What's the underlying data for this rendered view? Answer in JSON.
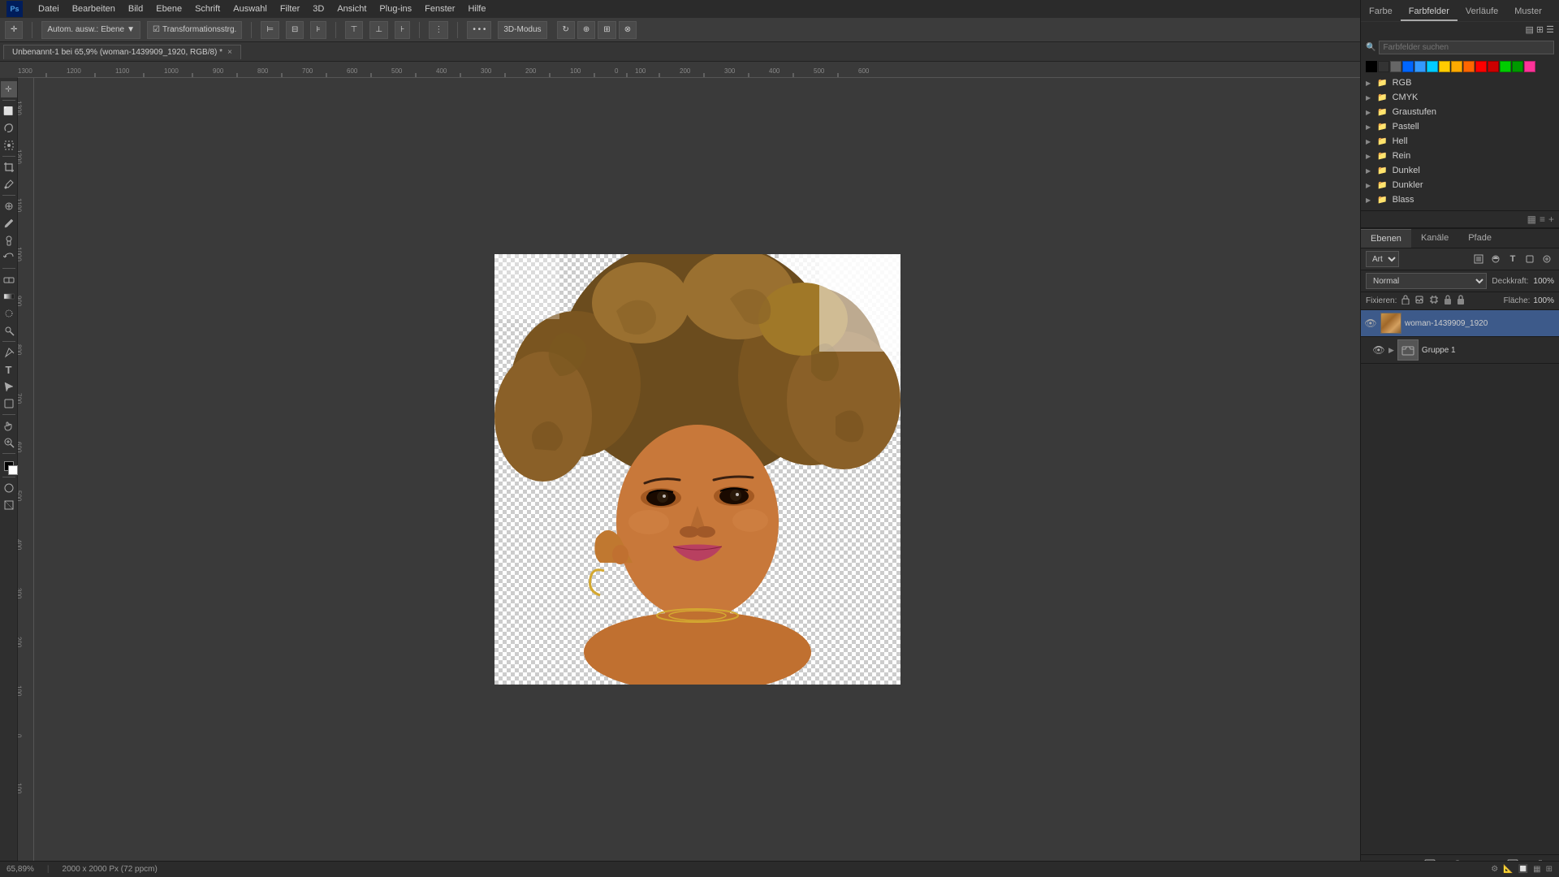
{
  "app": {
    "title": "Adobe Photoshop",
    "ps_label": "Ps"
  },
  "titlebar": {
    "menu_items": [
      "Datei",
      "Bearbeiten",
      "Bild",
      "Ebene",
      "Schrift",
      "Auswahl",
      "Filter",
      "3D",
      "Ansicht",
      "Plug-ins",
      "Fenster",
      "Hilfe"
    ],
    "window_title": "Unbenannt-1 bei 65,9% (woman-1439909_1920, RGB/8) *",
    "close_tab": "×"
  },
  "optionsbar": {
    "auto_label": "Autom. ausw.:",
    "ebene_label": "Ebene",
    "transformation_label": "Transformationsstrg.",
    "mode_3d_label": "3D-Modus"
  },
  "swatches": {
    "colors": [
      "#000000",
      "#333333",
      "#666666",
      "#0066ff",
      "#3399ff",
      "#ffcc00",
      "#ffaa00",
      "#ff6600",
      "#ff0000",
      "#cc0000",
      "#00cc00",
      "#009900",
      "#ff3399",
      "#cc0066"
    ]
  },
  "color_panel": {
    "tabs": [
      "Farbe",
      "Farbfelder",
      "Verläufe",
      "Muster"
    ],
    "active_tab": "Farbfelder",
    "search_placeholder": "Farbfelder suchen",
    "groups": [
      {
        "name": "RGB",
        "expanded": false
      },
      {
        "name": "CMYK",
        "expanded": false
      },
      {
        "name": "Graustufen",
        "expanded": false
      },
      {
        "name": "Pastell",
        "expanded": false
      },
      {
        "name": "Hell",
        "expanded": false
      },
      {
        "name": "Rein",
        "expanded": false
      },
      {
        "name": "Dunkel",
        "expanded": false
      },
      {
        "name": "Dunkler",
        "expanded": false
      },
      {
        "name": "Blass",
        "expanded": false
      }
    ]
  },
  "layers_panel": {
    "tabs": [
      "Ebenen",
      "Kanäle",
      "Pfade"
    ],
    "active_tab": "Ebenen",
    "type_label": "Art",
    "blend_mode": "Normal",
    "opacity_label": "Deckkraft:",
    "opacity_value": "100%",
    "fill_label": "Fläche:",
    "fill_value": "100%",
    "fixieren_label": "Fixieren:",
    "layers": [
      {
        "id": "woman-layer",
        "name": "woman-1439909_1920",
        "visible": true,
        "selected": true,
        "type": "image"
      }
    ],
    "groups": [
      {
        "id": "group1",
        "name": "Gruppe 1",
        "expanded": false,
        "type": "group"
      }
    ]
  },
  "canvas": {
    "zoom": "65,89%",
    "dimensions": "2000 x 2000 Px (72 ppcm)",
    "filename": "Unbenannt-1 bei 65,9% (woman-1439909_1920, RGB/8) *"
  },
  "statusbar": {
    "zoom": "65,89%",
    "dimensions": "2000 x 2000 Px (72 ppcm)"
  },
  "toolbar": {
    "tools": [
      {
        "name": "move",
        "icon": "✛",
        "title": "Verschieben"
      },
      {
        "name": "marquee",
        "icon": "⬜",
        "title": "Rechteckige Auswahl"
      },
      {
        "name": "lasso",
        "icon": "⌒",
        "title": "Lasso"
      },
      {
        "name": "magic-wand",
        "icon": "✦",
        "title": "Zauberstab"
      },
      {
        "name": "crop",
        "icon": "⊡",
        "title": "Freistellen"
      },
      {
        "name": "eyedropper",
        "icon": "⊘",
        "title": "Pipette"
      },
      {
        "name": "spot-heal",
        "icon": "✿",
        "title": "Reparatur"
      },
      {
        "name": "brush",
        "icon": "✏",
        "title": "Pinsel"
      },
      {
        "name": "clone-stamp",
        "icon": "✂",
        "title": "Kopierstempel"
      },
      {
        "name": "history-brush",
        "icon": "↩",
        "title": "Protokollpinsel"
      },
      {
        "name": "eraser",
        "icon": "◻",
        "title": "Radiergummi"
      },
      {
        "name": "gradient",
        "icon": "▦",
        "title": "Verlauf"
      },
      {
        "name": "dodge",
        "icon": "○",
        "title": "Abwedler"
      },
      {
        "name": "pen",
        "icon": "✒",
        "title": "Zeichenstift"
      },
      {
        "name": "text",
        "icon": "T",
        "title": "Text"
      },
      {
        "name": "path-selection",
        "icon": "▶",
        "title": "Pfadauswahl"
      },
      {
        "name": "shape",
        "icon": "▭",
        "title": "Form"
      },
      {
        "name": "hand",
        "icon": "✋",
        "title": "Hand"
      },
      {
        "name": "zoom",
        "icon": "🔍",
        "title": "Zoom"
      },
      {
        "name": "foreground-bg",
        "icon": "⬛",
        "title": "Vorder/Hintergrund"
      }
    ]
  },
  "icons": {
    "search": "🔍",
    "expand": "▶",
    "folder": "📁",
    "eye": "👁",
    "lock": "🔒",
    "link": "🔗",
    "new_layer": "📄",
    "delete_layer": "🗑",
    "adjust_layer": "◑",
    "mask_layer": "⬜",
    "group_layer": "📁",
    "fx_layer": "fx"
  }
}
